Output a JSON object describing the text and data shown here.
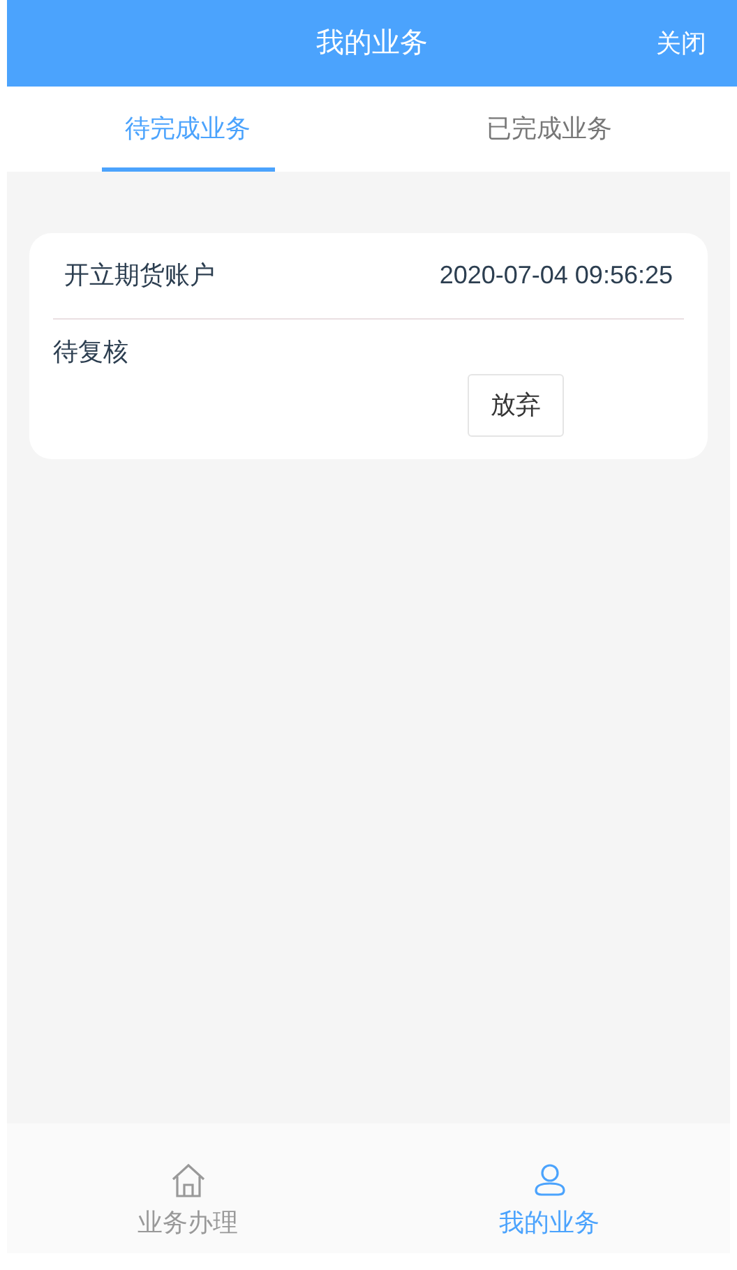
{
  "header": {
    "title": "我的业务",
    "close": "关闭"
  },
  "tabs": [
    {
      "label": "待完成业务",
      "selected": true
    },
    {
      "label": "已完成业务",
      "selected": false
    }
  ],
  "tasks": [
    {
      "name": "开立期货账户",
      "time": "2020-07-04 09:56:25",
      "status": "待复核",
      "action": "放弃"
    }
  ],
  "bottom_nav": [
    {
      "label": "业务办理",
      "selected": false
    },
    {
      "label": "我的业务",
      "selected": true
    }
  ]
}
